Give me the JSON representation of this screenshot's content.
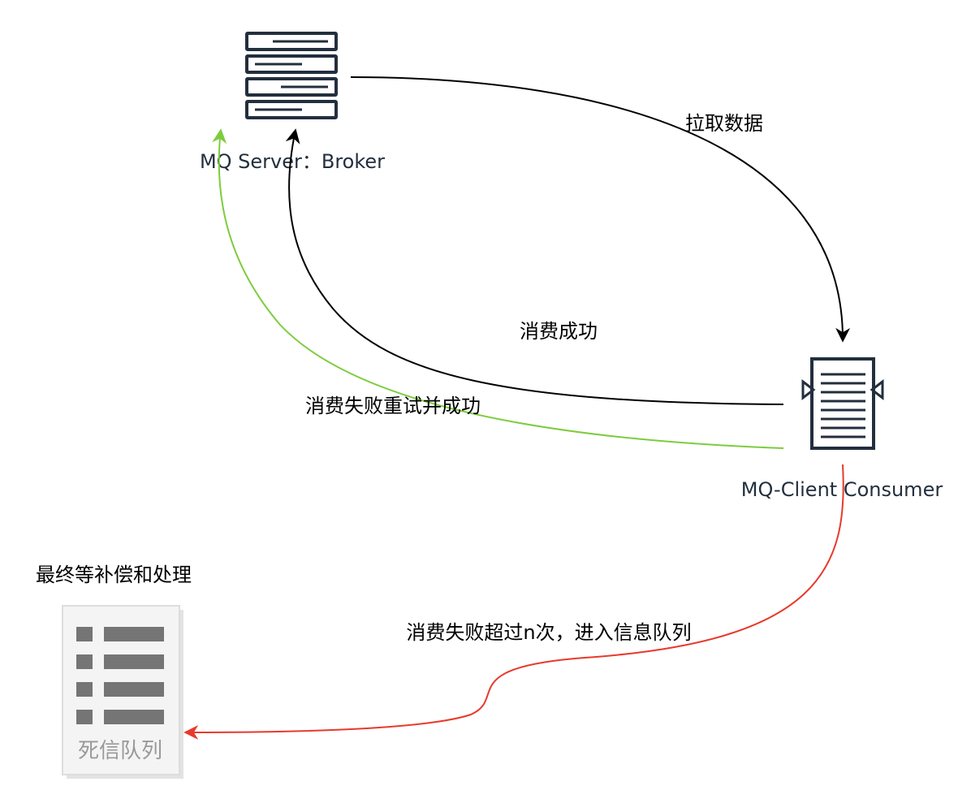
{
  "nodes": {
    "server": {
      "label": "MQ Server：Broker",
      "icon": "server-rack-icon"
    },
    "consumer": {
      "label": "MQ-Client Consumer",
      "icon": "queue-document-icon"
    },
    "dlq": {
      "label": "死信队列",
      "icon": "list-document-icon"
    }
  },
  "edges": {
    "pull": {
      "label": "拉取数据",
      "color": "#000000"
    },
    "consume_success": {
      "label": "消费成功",
      "color": "#000000"
    },
    "retry_success": {
      "label": "消费失败重试并成功",
      "color": "#7dcc3f"
    },
    "to_dlq": {
      "label": "消费失败超过n次，进入信息队列",
      "color": "#e8392c"
    }
  },
  "annotations": {
    "compensation": "最终等补偿和处理"
  },
  "colors": {
    "icon_dark": "#232f3e",
    "icon_grey": "#7a7a7a",
    "doc_bg": "#f2f2f2",
    "doc_border": "#d9d9d9"
  }
}
